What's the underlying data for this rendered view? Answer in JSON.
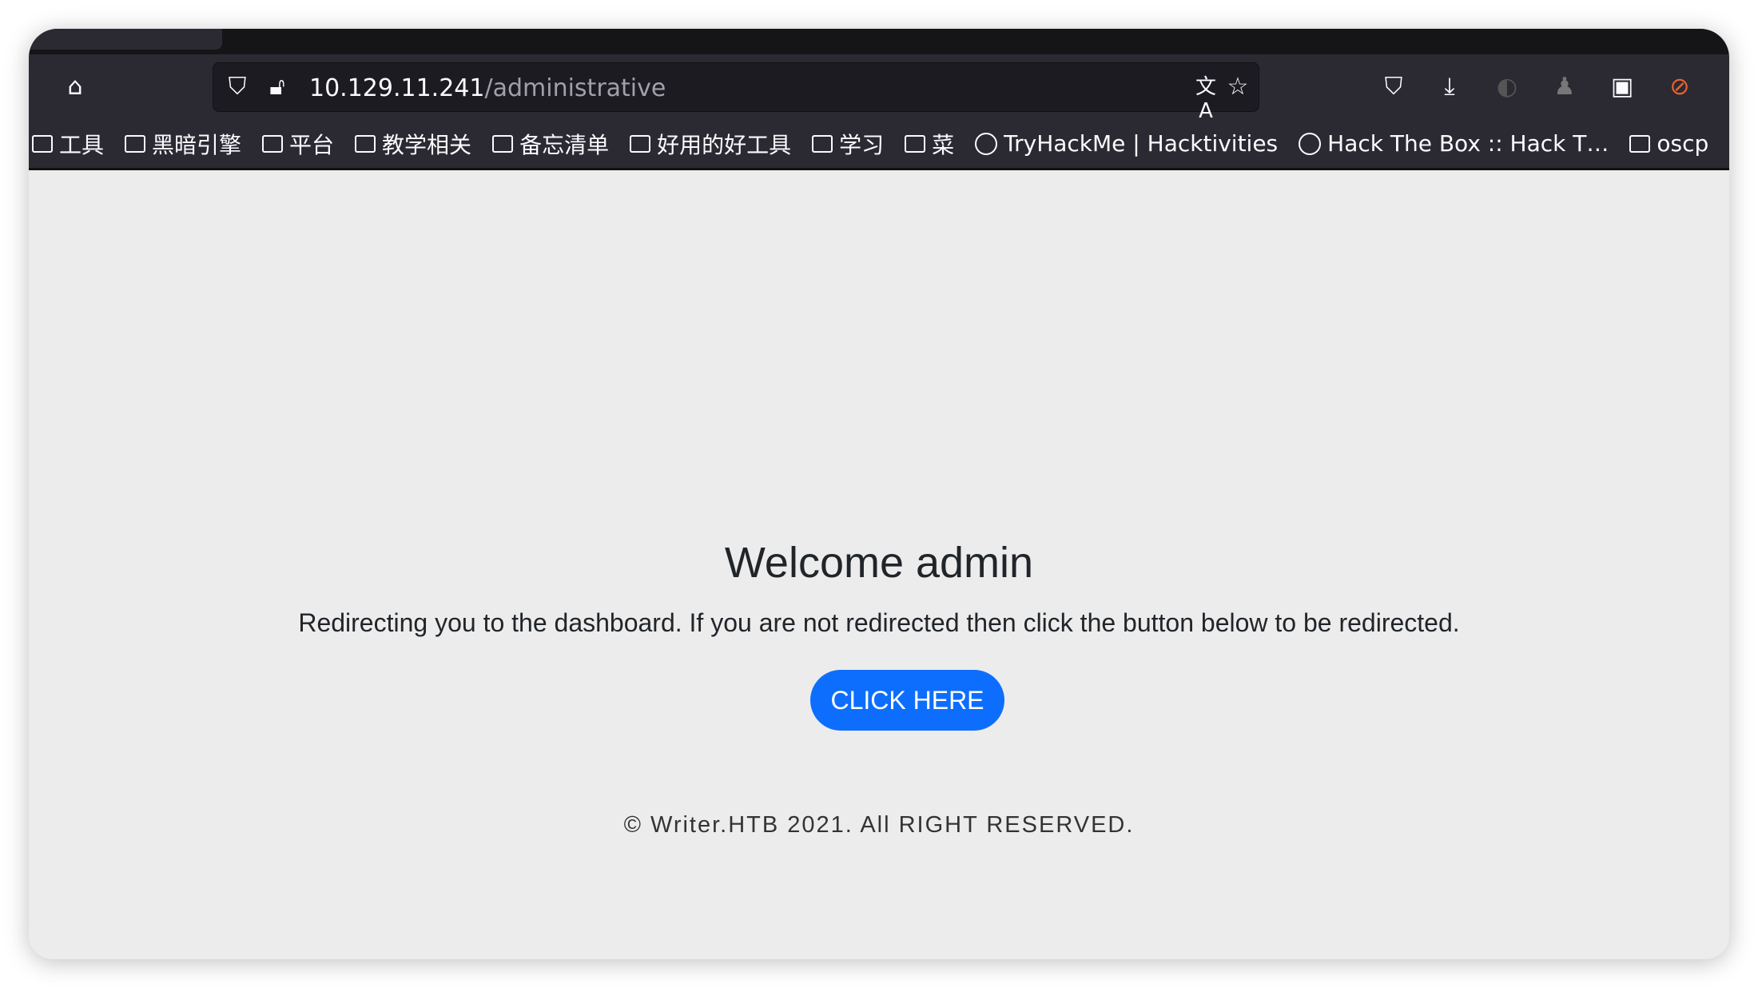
{
  "browser": {
    "url_host": "10.129.11.241",
    "url_path": "/administrative",
    "bookmarks": [
      {
        "label": "工具",
        "icon": "folder-icon"
      },
      {
        "label": "黑暗引擎",
        "icon": "folder-icon"
      },
      {
        "label": "平台",
        "icon": "folder-icon"
      },
      {
        "label": "教学相关",
        "icon": "folder-icon"
      },
      {
        "label": "备忘清单",
        "icon": "folder-icon"
      },
      {
        "label": "好用的好工具",
        "icon": "folder-icon"
      },
      {
        "label": "学习",
        "icon": "folder-icon"
      },
      {
        "label": "菜",
        "icon": "folder-icon"
      },
      {
        "label": "TryHackMe | Hacktivities",
        "icon": "globe-icon"
      },
      {
        "label": "Hack The Box :: Hack T…",
        "icon": "globe-icon"
      },
      {
        "label": "oscp",
        "icon": "folder-icon"
      }
    ]
  },
  "page": {
    "title": "Welcome admin",
    "message": "Redirecting you to the dashboard. If you are not redirected then click the button below to be redirected.",
    "button_label": "CLICK HERE",
    "footer": "© Writer.HTB 2021. All RIGHT RESERVED.",
    "button_color": "#0d6efd"
  }
}
